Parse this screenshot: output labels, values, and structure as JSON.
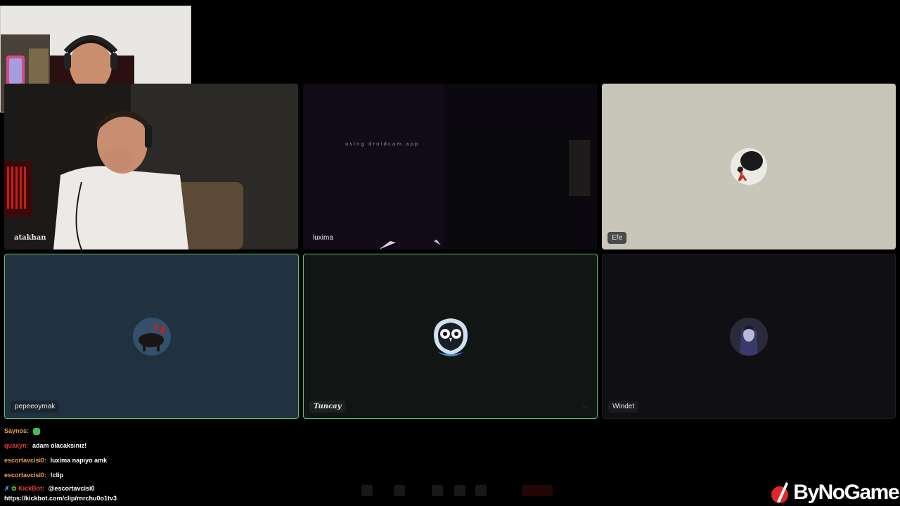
{
  "participants": [
    {
      "name": "atakhan",
      "type": "video"
    },
    {
      "name": "luxima",
      "type": "video",
      "overlay_text": "using droidcam.app"
    },
    {
      "name": "Efe",
      "type": "avatar",
      "background": "#c8c6b8"
    },
    {
      "name": "pepeeoymak",
      "type": "avatar",
      "background": "#20313f",
      "speaking": true
    },
    {
      "name": "Tuncay",
      "type": "avatar",
      "background": "#111615",
      "speaking": true
    },
    {
      "name": "Windet",
      "type": "avatar",
      "background": "#101014"
    }
  ],
  "tile_menu": "···",
  "chat": [
    {
      "user": "Saynos:",
      "user_color": "#e8a24a",
      "message": "",
      "emote": "green-emote"
    },
    {
      "user": "quaxyn:",
      "user_color": "#e23c3c",
      "message": "adam olacaksınız!"
    },
    {
      "user": "escortavcisi0:",
      "user_color": "#e8a24a",
      "message": "luxima napıyo amk"
    },
    {
      "user": "escortavcisi0:",
      "user_color": "#e8a24a",
      "message": "!clip"
    },
    {
      "user": "KickBot:",
      "user_color": "#e23c3c",
      "message": "@escortavcisi0",
      "badges": [
        "sword-badge",
        "bot-badge"
      ]
    },
    {
      "user": "",
      "user_color": "#ffffff",
      "message": "https://kickbot.com/clip/rnrchu0o1tv3"
    }
  ],
  "brand": {
    "name": "ByNoGame",
    "color": "#e0262b"
  },
  "colors": {
    "speaking_border": "#5fbf72",
    "background": "#000000"
  }
}
